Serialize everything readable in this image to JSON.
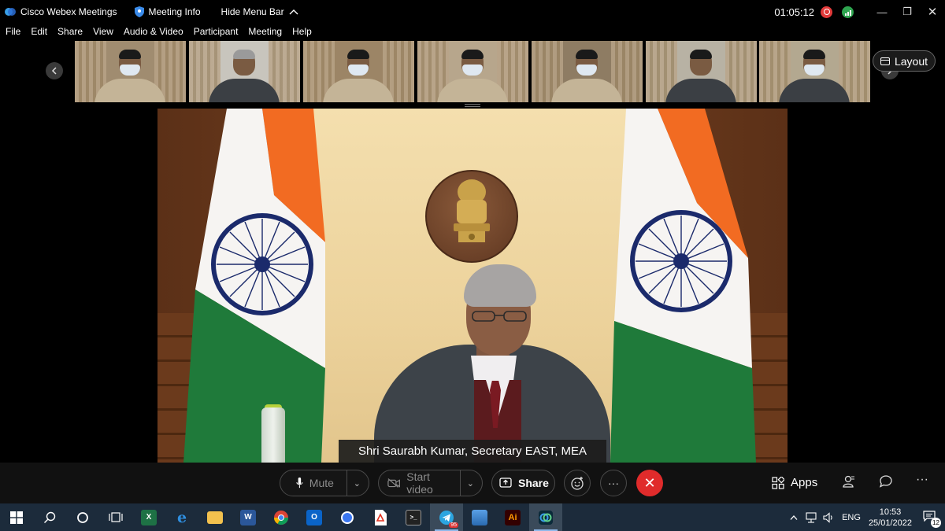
{
  "titlebar": {
    "app_name": "Cisco Webex Meetings",
    "meeting_info": "Meeting Info",
    "hide_menu": "Hide Menu Bar",
    "elapsed": "01:05:12"
  },
  "menu": [
    "File",
    "Edit",
    "Share",
    "View",
    "Audio & Video",
    "Participant",
    "Meeting",
    "Help"
  ],
  "layout_label": "Layout",
  "thumbnails": [
    {
      "bg": "#a08c70",
      "uniform": true,
      "mask": true
    },
    {
      "bg": "#c8c5bd",
      "uniform": false,
      "mask": false
    },
    {
      "bg": "#9c8566",
      "uniform": true,
      "mask": true
    },
    {
      "bg": "#b7a68c",
      "uniform": true,
      "mask": true
    },
    {
      "bg": "#8e7c63",
      "uniform": true,
      "mask": true
    },
    {
      "bg": "#b8b2a4",
      "uniform": false,
      "mask": false
    },
    {
      "bg": "#b3a890",
      "uniform": false,
      "mask": true
    }
  ],
  "speaker_caption": "Shri Saurabh Kumar, Secretary EAST, MEA",
  "controls": {
    "mute": "Mute",
    "start_video": "Start video",
    "share": "Share",
    "apps": "Apps"
  },
  "taskbar": {
    "language": "ENG",
    "time": "10:53",
    "date": "25/01/2022",
    "notifications": "12",
    "telegram_badge": "95"
  },
  "colors": {
    "end_call": "#e02b2b",
    "saffron": "#f26b22",
    "green": "#1f7a3a",
    "chakra": "#1b2a6b"
  }
}
